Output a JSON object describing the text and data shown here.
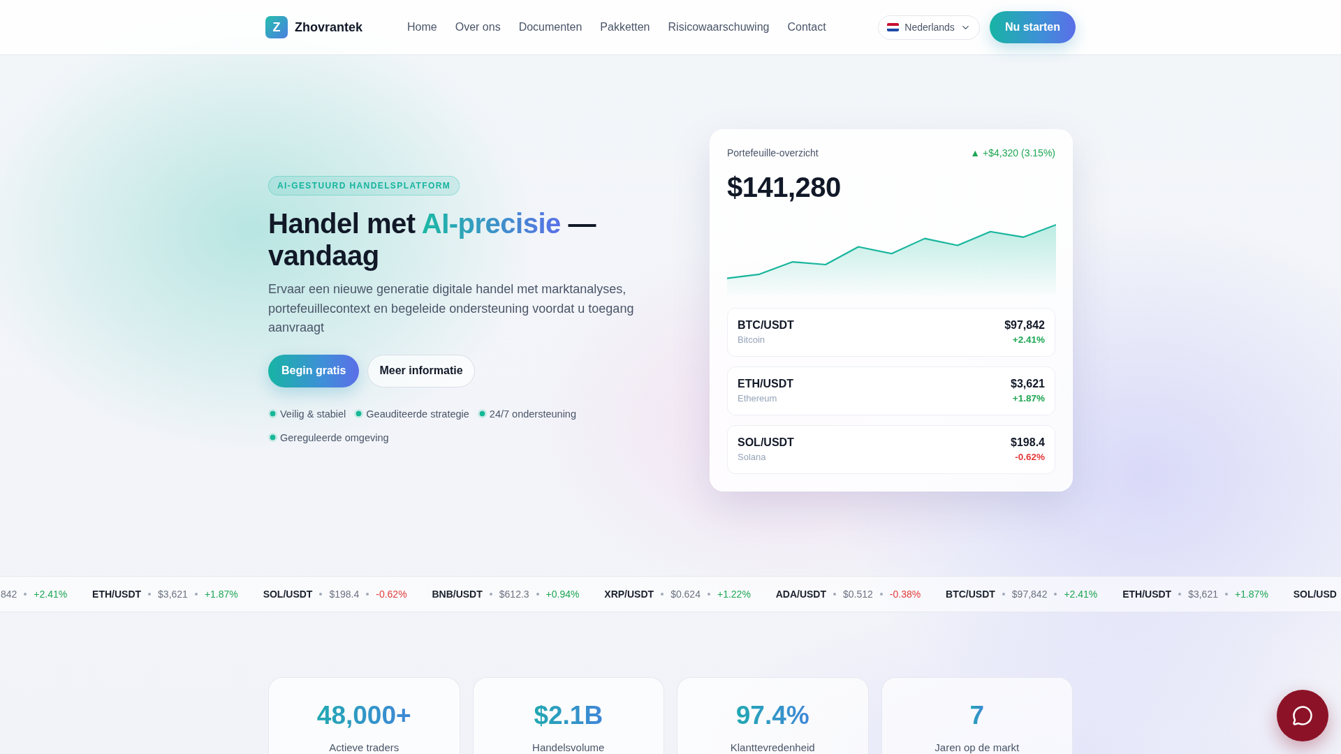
{
  "header": {
    "brand": {
      "mark": "Z",
      "name": "Zhovrantek"
    },
    "nav": [
      "Home",
      "Over ons",
      "Documenten",
      "Pakketten",
      "Risicowaarschuwing",
      "Contact"
    ],
    "language": "Nederlands",
    "cta": "Nu starten"
  },
  "hero": {
    "badge": "AI-GESTUURD HANDELSPLATFORM",
    "title": {
      "before": "Handel met",
      "highlight": "AI-precisie",
      "after": "— vandaag"
    },
    "description": "Ervaar een nieuwe generatie digitale handel met marktanalyses, portefeuillecontext en begeleide ondersteuning voordat u toegang aanvraagt",
    "buttons": [
      {
        "label": "Begin gratis",
        "kind": "primary"
      },
      {
        "label": "Meer informatie",
        "kind": "secondary"
      }
    ],
    "features": [
      "Veilig & stabiel",
      "Geauditeerde strategie",
      "24/7 ondersteuning",
      "Gereguleerde omgeving"
    ]
  },
  "portfolio": {
    "title": "Portefeuille-overzicht",
    "change": {
      "text": "▲ +$4,320 (3.15%)",
      "rising": true
    },
    "total": "$141,280",
    "assets": [
      {
        "pair": "BTC/USDT",
        "name": "Bitcoin",
        "price": "$97,842",
        "change": "+2.41%",
        "rising": true
      },
      {
        "pair": "ETH/USDT",
        "name": "Ethereum",
        "price": "$3,621",
        "change": "+1.87%",
        "rising": true
      },
      {
        "pair": "SOL/USDT",
        "name": "Solana",
        "price": "$198.4",
        "change": "-0.62%",
        "rising": false
      }
    ]
  },
  "ticker": [
    {
      "price": "842",
      "change": "+2.41%",
      "rising": true
    },
    {
      "pair": "ETH/USDT",
      "price": "$3,621",
      "change": "+1.87%",
      "rising": true
    },
    {
      "pair": "SOL/USDT",
      "price": "$198.4",
      "change": "-0.62%",
      "rising": false
    },
    {
      "pair": "BNB/USDT",
      "price": "$612.3",
      "change": "+0.94%",
      "rising": true
    },
    {
      "pair": "XRP/USDT",
      "price": "$0.624",
      "change": "+1.22%",
      "rising": true
    },
    {
      "pair": "ADA/USDT",
      "price": "$0.512",
      "change": "-0.38%",
      "rising": false
    },
    {
      "pair": "BTC/USDT",
      "price": "$97,842",
      "change": "+2.41%",
      "rising": true
    },
    {
      "pair": "ETH/USDT",
      "price": "$3,621",
      "change": "+1.87%",
      "rising": true
    },
    {
      "pair": "SOL/USD"
    }
  ],
  "stats": [
    {
      "value": "48,000+",
      "label": "Actieve traders"
    },
    {
      "value": "$2.1B",
      "label": "Handelsvolume"
    },
    {
      "value": "97.4%",
      "label": "Klanttevredenheid"
    },
    {
      "value": "7",
      "label": "Jaren op de markt"
    }
  ]
}
